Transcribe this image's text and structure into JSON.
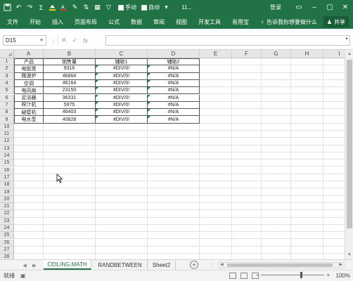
{
  "titlebar": {
    "autosave_label": "手动",
    "autosave_label2": "自动",
    "filename": "11...",
    "login": "登录",
    "color": "#217346"
  },
  "ribbon": {
    "tabs": [
      "文件",
      "开始",
      "插入",
      "页面布局",
      "公式",
      "数据",
      "审阅",
      "视图",
      "开发工具",
      "易用宝"
    ],
    "tellme": "告诉我你想要做什么",
    "share": "共享"
  },
  "formula_bar": {
    "name_box": "D15",
    "fx_label": "fx",
    "value": ""
  },
  "columns": [
    "A",
    "B",
    "C",
    "D",
    "E",
    "F",
    "G",
    "H",
    "I"
  ],
  "rows_count": 31,
  "table": {
    "headers": [
      "产品",
      "销售量",
      "辅助1",
      "辅助2"
    ],
    "rows": [
      [
        "电饭煲",
        "9316",
        "#DIV/0!",
        "#N/A"
      ],
      [
        "微波炉",
        "46864",
        "#DIV/0!",
        "#N/A"
      ],
      [
        "空调",
        "46164",
        "#DIV/0!",
        "#N/A"
      ],
      [
        "电风扇",
        "23150",
        "#DIV/0!",
        "#N/A"
      ],
      [
        "足浴器",
        "36331",
        "#DIV/0!",
        "#N/A"
      ],
      [
        "榨汁机",
        "5975",
        "#DIV/0!",
        "#N/A"
      ],
      [
        "破壁机",
        "46403",
        "#DIV/0!",
        "#N/A"
      ],
      [
        "电水壶",
        "40828",
        "#DIV/0!",
        "#N/A"
      ]
    ]
  },
  "sheets": [
    {
      "name": "CEILING.MATH",
      "active": true
    },
    {
      "name": "RANDBETWEEN",
      "active": false
    },
    {
      "name": "Sheet2",
      "active": false
    }
  ],
  "statusbar": {
    "status": "就绪",
    "zoom": "100%",
    "zoom_level": 1.0
  }
}
